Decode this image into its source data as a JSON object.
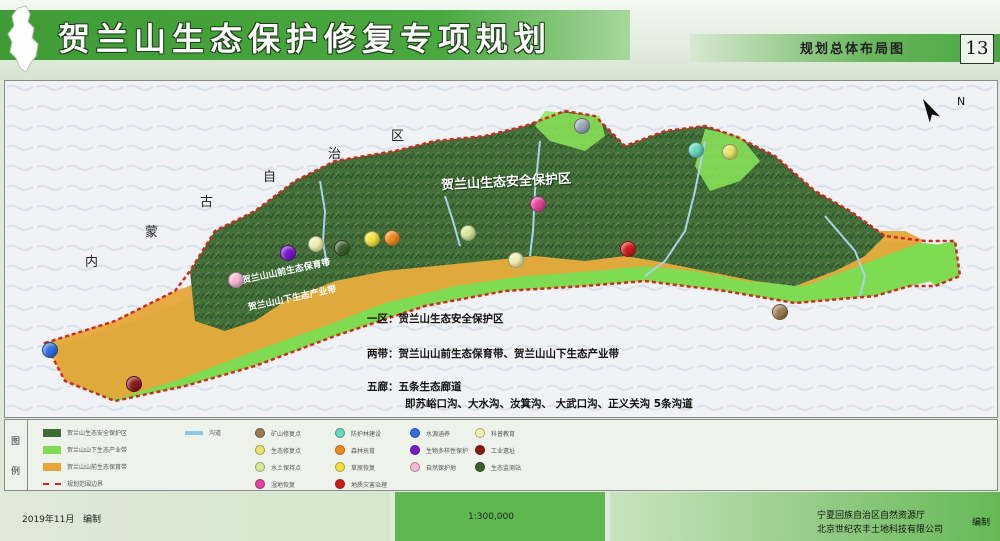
{
  "header": {
    "title": "贺兰山生态保护修复专项规划",
    "subtitle": "规划总体布局图",
    "sheet_number": "13"
  },
  "map": {
    "region_labels": [
      "内",
      "蒙",
      "古",
      "自",
      "治",
      "区"
    ],
    "protection_zone_label": "贺兰山生态安全保护区",
    "belt1_label": "贺兰山山前生态保育带",
    "belt2_label": "贺兰山山下生态产业带",
    "north_symbol": "N",
    "annotations": {
      "zone_line": "一区：贺兰山生态安全保护区",
      "belt_line": "两带：贺兰山山前生态保育带、贺兰山山下生态产业带",
      "corridor_line": "五廊：五条生态廊道",
      "corridor_detail": "即苏峪口沟、大水沟、汝箕沟、 大武口沟、正义关沟 5条沟道"
    },
    "colors": {
      "mountain": "#3f6b34",
      "front_belt": "#e6a63a",
      "industry_belt": "#7fdb52",
      "river": "#a9d3ec",
      "boundary": "#d02a1d"
    }
  },
  "legend": {
    "tag_chars": [
      "图",
      "例"
    ],
    "items": [
      {
        "kind": "swatch",
        "color": "#3f6b34",
        "label": "贺兰山生态安全保护区"
      },
      {
        "kind": "swatch",
        "color": "#7fdb52",
        "label": "贺兰山山下生态产业带"
      },
      {
        "kind": "swatch",
        "color": "#e6a63a",
        "label": "贺兰山山前生态保育带"
      },
      {
        "kind": "dashed",
        "color": "#d02a1d",
        "label": "规划范围边界"
      },
      {
        "kind": "line",
        "color": "#8fc6e6",
        "label": "沟道"
      },
      {
        "kind": "dot",
        "color": "#9b7b52",
        "label": "矿山修复点"
      },
      {
        "kind": "dot",
        "color": "#e4e36a",
        "label": "生态修复点"
      },
      {
        "kind": "dot",
        "color": "#d8e89a",
        "label": "水土保持点"
      },
      {
        "kind": "dot",
        "color": "#e3449f",
        "label": "湿地恢复"
      },
      {
        "kind": "dot",
        "color": "#65d6bf",
        "label": "防护林建设"
      },
      {
        "kind": "dot",
        "color": "#f08a1e",
        "label": "森林抚育"
      },
      {
        "kind": "dot",
        "color": "#f4e43a",
        "label": "草原恢复"
      },
      {
        "kind": "dot",
        "color": "#cf1c1c",
        "label": "地质灾害治理"
      },
      {
        "kind": "dot",
        "color": "#2f6fe0",
        "label": "水源涵养"
      },
      {
        "kind": "dot",
        "color": "#7a19c9",
        "label": "生物多样性保护"
      },
      {
        "kind": "dot",
        "color": "#f3b8d4",
        "label": "自然保护地"
      },
      {
        "kind": "dot",
        "color": "#f1f1b0",
        "label": "科普教育"
      },
      {
        "kind": "dot",
        "color": "#8a1a1a",
        "label": "工业遗址"
      },
      {
        "kind": "dot",
        "color": "#3c5e2e",
        "label": "生态监测站"
      }
    ]
  },
  "footer": {
    "date": "2019年11月",
    "edit_label": "编制",
    "scale": "1:300,000",
    "org1": "宁夏回族自治区自然资源厅",
    "org2": "北京世纪农丰土地科技有限公司",
    "edit_label2": "编制"
  }
}
